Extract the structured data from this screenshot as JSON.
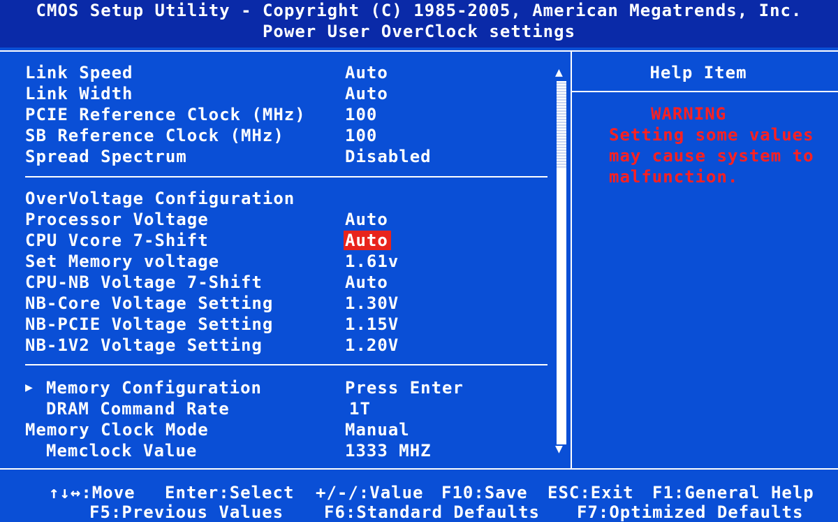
{
  "header": {
    "title": "CMOS Setup Utility - Copyright (C) 1985-2005, American Megatrends, Inc.",
    "subtitle": "Power User OverClock settings"
  },
  "settings": {
    "link_speed": {
      "label": "Link Speed",
      "value": "Auto"
    },
    "link_width": {
      "label": "Link Width",
      "value": "Auto"
    },
    "pcie_ref_clock": {
      "label": "PCIE Reference Clock (MHz)",
      "value": "100"
    },
    "sb_ref_clock": {
      "label": "SB Reference Clock (MHz)",
      "value": "100"
    },
    "spread_spectrum": {
      "label": "Spread Spectrum",
      "value": "Disabled"
    },
    "overvoltage_header": {
      "label": "OverVoltage Configuration"
    },
    "processor_voltage": {
      "label": "Processor Voltage",
      "value": "Auto"
    },
    "cpu_vcore_shift": {
      "label": "CPU Vcore 7-Shift",
      "value": "Auto"
    },
    "memory_voltage": {
      "label": "Set Memory voltage",
      "value": "1.61v"
    },
    "cpu_nb_shift": {
      "label": "CPU-NB Voltage 7-Shift",
      "value": "Auto"
    },
    "nb_core": {
      "label": "NB-Core Voltage Setting",
      "value": "1.30V"
    },
    "nb_pcie": {
      "label": "NB-PCIE Voltage Setting",
      "value": "1.15V"
    },
    "nb_1v2": {
      "label": "NB-1V2 Voltage Setting",
      "value": "1.20V"
    },
    "memory_config": {
      "label": "Memory Configuration",
      "value": "Press Enter",
      "marker": "▶"
    },
    "dram_cmd_rate": {
      "label": "DRAM Command Rate",
      "value": "1T"
    },
    "memory_clock_mode": {
      "label": "Memory Clock Mode",
      "value": "Manual"
    },
    "memclock_value": {
      "label": "Memclock Value",
      "value": "1333 MHZ"
    }
  },
  "scroll": {
    "up": "▲",
    "down": "▼"
  },
  "help": {
    "title": "Help Item",
    "warning_title": "WARNING",
    "warning_line1": "Setting some values",
    "warning_line2": "may cause system to",
    "warning_line3": "malfunction."
  },
  "footer": {
    "move": "↑↓↔:Move",
    "select": "Enter:Select",
    "value": "+/-/:Value",
    "save": "F10:Save",
    "exit": "ESC:Exit",
    "help": "F1:General Help",
    "prev": "F5:Previous Values",
    "standard": "F6:Standard Defaults",
    "optimized": "F7:Optimized Defaults"
  },
  "colors": {
    "background": "#0a4fd6",
    "header": "#0a2aa8",
    "selected": "#e8241c",
    "warning": "#ff2020"
  }
}
